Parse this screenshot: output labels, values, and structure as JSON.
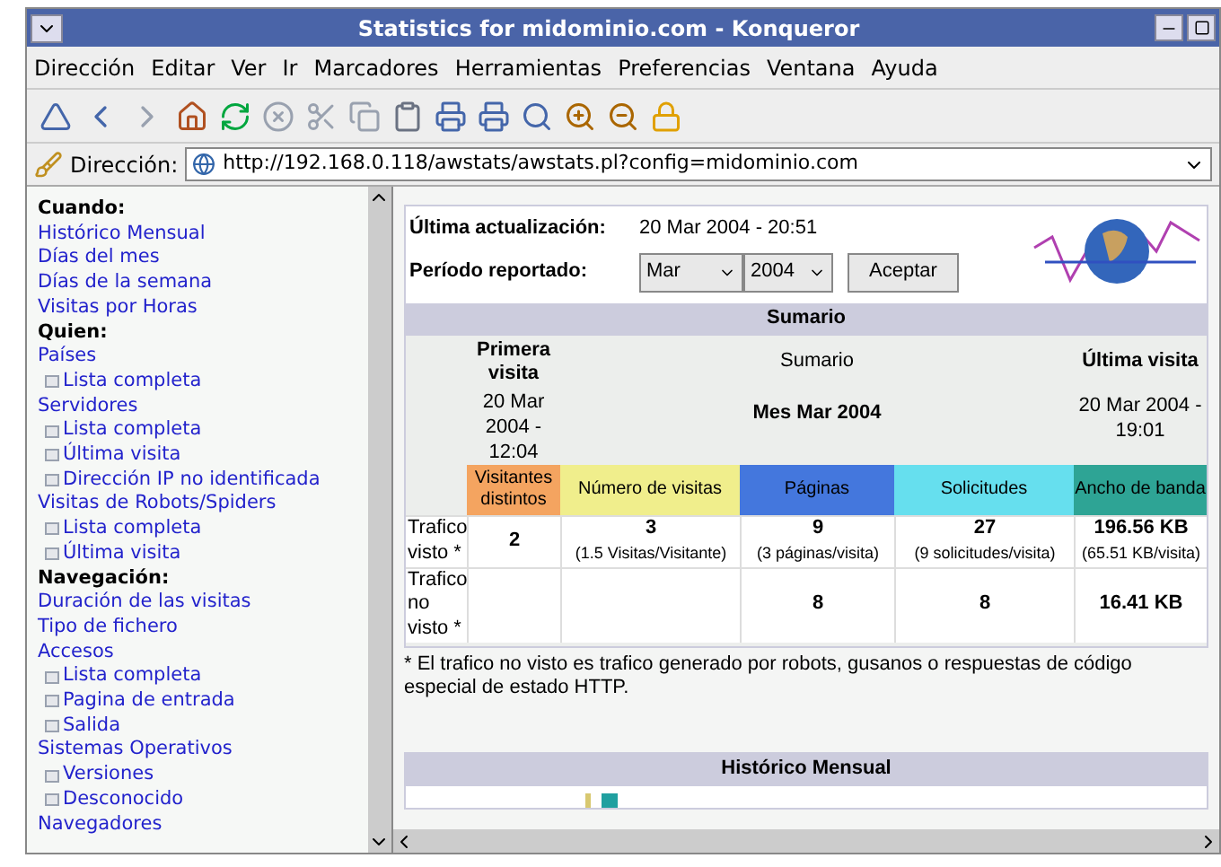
{
  "window": {
    "title": "Statistics for midominio.com - Konqueror"
  },
  "menu": [
    {
      "label": "Dirección"
    },
    {
      "label": "Editar"
    },
    {
      "label": "Ver"
    },
    {
      "label": "Ir"
    },
    {
      "label": "Marcadores"
    },
    {
      "label": "Herramientas"
    },
    {
      "label": "Preferencias"
    },
    {
      "label": "Ventana"
    },
    {
      "label": "Ayuda"
    }
  ],
  "address_bar": {
    "label": "Dirección:",
    "value": "http://192.168.0.118/awstats/awstats.pl?config=midominio.com"
  },
  "sidebar": {
    "items": [
      {
        "kind": "header",
        "label": "Cuando:"
      },
      {
        "kind": "link",
        "label": "Histórico Mensual"
      },
      {
        "kind": "link",
        "label": "Días del mes"
      },
      {
        "kind": "link",
        "label": "Días de la semana"
      },
      {
        "kind": "link",
        "label": "Visitas por Horas"
      },
      {
        "kind": "header",
        "label": "Quien:"
      },
      {
        "kind": "link",
        "label": "Países"
      },
      {
        "kind": "sublink",
        "label": "Lista completa"
      },
      {
        "kind": "link",
        "label": "Servidores"
      },
      {
        "kind": "sublink",
        "label": "Lista completa"
      },
      {
        "kind": "sublink",
        "label": "Última visita"
      },
      {
        "kind": "sublink",
        "label": "Dirección IP no identificada"
      },
      {
        "kind": "link",
        "label": "Visitas de Robots/Spiders"
      },
      {
        "kind": "sublink",
        "label": "Lista completa"
      },
      {
        "kind": "sublink",
        "label": "Última visita"
      },
      {
        "kind": "header",
        "label": "Navegación:"
      },
      {
        "kind": "link",
        "label": "Duración de las visitas"
      },
      {
        "kind": "link",
        "label": "Tipo de fichero"
      },
      {
        "kind": "link",
        "label": "Accesos"
      },
      {
        "kind": "sublink",
        "label": "Lista completa"
      },
      {
        "kind": "sublink",
        "label": "Pagina de entrada"
      },
      {
        "kind": "sublink",
        "label": "Salida"
      },
      {
        "kind": "link",
        "label": "Sistemas Operativos"
      },
      {
        "kind": "sublink",
        "label": "Versiones"
      },
      {
        "kind": "sublink",
        "label": "Desconocido"
      },
      {
        "kind": "link",
        "label": "Navegadores"
      }
    ]
  },
  "header": {
    "last_update_label": "Última actualización:",
    "last_update": "20 Mar 2004 - 20:51",
    "period_label": "Período reportado:",
    "month": "Mar",
    "year": "2004",
    "button": "Aceptar"
  },
  "summary": {
    "title": "Sumario",
    "first_visit_label": "Primera visita",
    "first_visit": "20 Mar 2004 - 12:04",
    "summary_label": "Sumario",
    "period": "Mes Mar 2004",
    "last_visit_label": "Última visita",
    "last_visit": "20 Mar 2004 - 19:01",
    "columns": [
      {
        "label": "Visitantes distintos",
        "color": "#f4a460"
      },
      {
        "label": "Número de visitas",
        "color": "#f0ee8c"
      },
      {
        "label": "Páginas",
        "color": "#4477dd"
      },
      {
        "label": "Solicitudes",
        "color": "#66dfee"
      },
      {
        "label": "Ancho de banda",
        "color": "#2ea495"
      }
    ],
    "rows": [
      {
        "label": "Trafico visto *",
        "cells": [
          {
            "value": "2"
          },
          {
            "value": "3",
            "detail": "(1.5 Visitas/Visitante)"
          },
          {
            "value": "9",
            "detail": "(3 páginas/visita)"
          },
          {
            "value": "27",
            "detail": "(9 solicitudes/visita)"
          },
          {
            "value": "196.56 KB",
            "detail": "(65.51 KB/visita)"
          }
        ]
      },
      {
        "label": "Trafico no visto *",
        "cells": [
          {},
          {},
          {
            "value": "8"
          },
          {
            "value": "8"
          },
          {
            "value": "16.41 KB"
          }
        ]
      }
    ],
    "footnote": "* El trafico no visto es trafico generado por robots, gusanos o respuestas de código especial de estado HTTP."
  },
  "monthly": {
    "title": "Histórico Mensual"
  }
}
